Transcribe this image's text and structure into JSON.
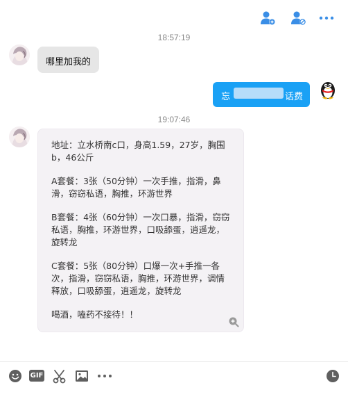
{
  "colors": {
    "accent": "#1aa1f5",
    "icon_blue": "#3a8ee6",
    "bubble_left": "#e6e6e6",
    "card_bg": "#f4f2f5",
    "timestamp": "#8a8a8a"
  },
  "top_toolbar": {
    "icons": [
      "add-friend-icon",
      "block-user-icon",
      "more-icon"
    ]
  },
  "messages": [
    {
      "time": "18:57:19",
      "side": "left",
      "text": "哪里加我的"
    },
    {
      "side": "right",
      "text_start": "忘",
      "text_end": "话费"
    },
    {
      "time": "19:07:46",
      "side": "left",
      "paragraphs": [
        "地址：立水桥南c口，身高1.59，27岁，胸围b，46公斤",
        "A套餐：3张（50分钟）一次手推，指滑，鼻滑，窃窃私语，胸推，环游世界",
        "B套餐：4张（60分钟）一次口暴，指滑，窃窃私语，胸推，环游世界，口吸舔蛋，逍遥龙，旋转龙",
        "C套餐：5张（80分钟）口爆一次+手推一各次，指滑，窃窃私语，胸推，环游世界，调情释放，口吸舔蛋，逍遥龙，旋转龙",
        "喝酒，嗑药不接待！！"
      ]
    }
  ],
  "bottom_toolbar": {
    "gif_label": "GIF",
    "icons": [
      "emoji-icon",
      "gif-icon",
      "scissors-icon",
      "image-icon",
      "more-icon",
      "history-clock-icon"
    ]
  }
}
